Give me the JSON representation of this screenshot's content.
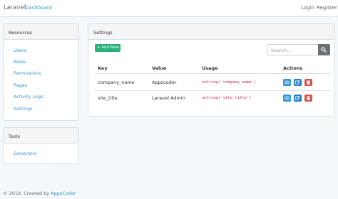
{
  "navbar": {
    "brand": "Laravel",
    "dashboard": "Dashboard",
    "login": "Login",
    "register": "Register"
  },
  "sidebar": {
    "resources_title": "Resources",
    "items": [
      {
        "label": "Users"
      },
      {
        "label": "Roles"
      },
      {
        "label": "Permissions"
      },
      {
        "label": "Pages"
      },
      {
        "label": "Activity Logs"
      },
      {
        "label": "Settings"
      }
    ],
    "tools_title": "Tools",
    "tools_items": [
      {
        "label": "Generator"
      }
    ]
  },
  "settings": {
    "title": "Settings",
    "add_label": "+ Add New",
    "search_placeholder": "Search...",
    "columns": [
      "Key",
      "Value",
      "Usage",
      "Actions"
    ],
    "rows": [
      {
        "key": "company_name",
        "value": "Appzcoder",
        "usage": "setting('company_name')"
      },
      {
        "key": "site_title",
        "value": "Laravel Admin",
        "usage": "setting('site_title')"
      }
    ]
  },
  "footer": {
    "prefix": "© 2018. Created by",
    "link": "AppzCoder"
  },
  "colors": {
    "link": "#3097d1",
    "success": "#2ab27b",
    "danger": "#d9534f",
    "code": "#c7254e"
  },
  "icons": {
    "search": "search-icon",
    "view": "eye-icon",
    "edit": "edit-icon",
    "delete": "trash-icon"
  }
}
